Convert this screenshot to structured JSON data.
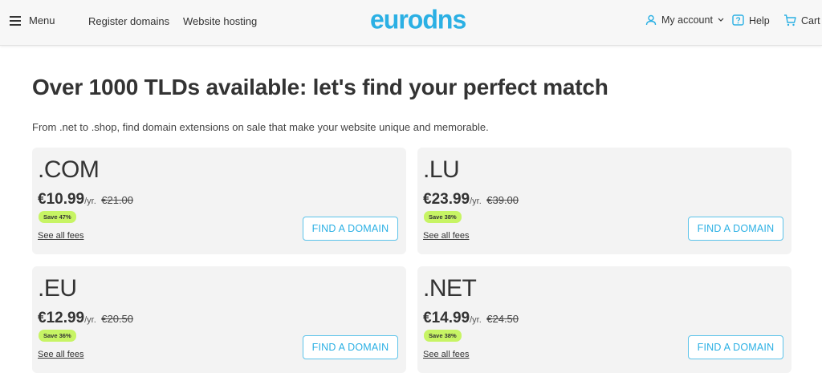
{
  "header": {
    "menu_label": "Menu",
    "nav": [
      {
        "label": "Register domains"
      },
      {
        "label": "Website hosting"
      }
    ],
    "logo_text": "eurodns",
    "account_label": "My account",
    "help_label": "Help",
    "cart_label": "Cart"
  },
  "hero": {
    "title": "Over 1000 TLDs available: let's find your perfect match",
    "subtitle": "From .net to .shop, find domain extensions on sale that make your website unique and memorable."
  },
  "cards": [
    {
      "tld": ".COM",
      "price": "€10.99",
      "unit": "/yr.",
      "old_price": "€21.00",
      "badge": "Save 47%",
      "fees": "See all fees",
      "button": "FIND A DOMAIN"
    },
    {
      "tld": ".LU",
      "price": "€23.99",
      "unit": "/yr.",
      "old_price": "€39.00",
      "badge": "Save 38%",
      "fees": "See all fees",
      "button": "FIND A DOMAIN"
    },
    {
      "tld": ".EU",
      "price": "€12.99",
      "unit": "/yr.",
      "old_price": "€20.50",
      "badge": "Save 36%",
      "fees": "See all fees",
      "button": "FIND A DOMAIN"
    },
    {
      "tld": ".NET",
      "price": "€14.99",
      "unit": "/yr.",
      "old_price": "€24.50",
      "badge": "Save 38%",
      "fees": "See all fees",
      "button": "FIND A DOMAIN"
    }
  ],
  "colors": {
    "brand": "#2bb0e4",
    "badge": "#c7f464",
    "card_bg": "#f3f3f3"
  }
}
